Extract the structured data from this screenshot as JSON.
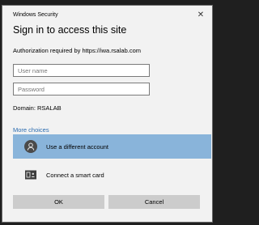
{
  "window": {
    "app_title": "Windows Security",
    "close_label": "✕"
  },
  "dialog": {
    "heading": "Sign in to access this site",
    "auth_message": "Authorization required by https://iwa.rsalab.com",
    "username": {
      "value": "",
      "placeholder": "User name"
    },
    "password": {
      "value": "",
      "placeholder": "Password"
    },
    "domain_text": "Domain: RSALAB",
    "more_choices_label": "More choices",
    "options": [
      {
        "label": "Use a different account",
        "icon": "user-avatar-icon",
        "selected": true
      },
      {
        "label": "Connect a smart card",
        "icon": "smart-card-icon",
        "selected": false
      }
    ]
  },
  "buttons": {
    "ok_label": "OK",
    "cancel_label": "Cancel"
  },
  "colors": {
    "selected_option": "#89b4da",
    "link": "#2b6cb0",
    "button": "#cccccc"
  }
}
